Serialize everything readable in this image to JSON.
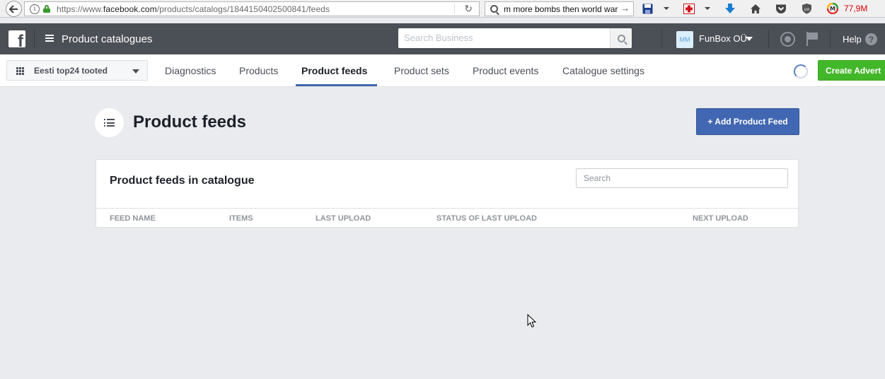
{
  "browser": {
    "url_prefix": "https://www.",
    "url_domain": "facebook.com",
    "url_path": "/products/catalogs/1844150402500841/feeds",
    "search_query": "m more bombs then world war",
    "memory": "77,9M"
  },
  "fb_bar": {
    "section_title": "Product catalogues",
    "search_placeholder": "Search Business",
    "avatar_initials": "MM",
    "account_name": "FunBox OÜ",
    "help_label": "Help"
  },
  "subnav": {
    "catalog_name": "Eesti top24 tooted",
    "tabs": [
      {
        "label": "Diagnostics",
        "active": false
      },
      {
        "label": "Products",
        "active": false
      },
      {
        "label": "Product feeds",
        "active": true
      },
      {
        "label": "Product sets",
        "active": false
      },
      {
        "label": "Product events",
        "active": false
      },
      {
        "label": "Catalogue settings",
        "active": false
      }
    ],
    "create_advert_label": "Create Advert"
  },
  "main": {
    "page_title": "Product feeds",
    "add_feed_label": "+ Add Product Feed",
    "card": {
      "title": "Product feeds in catalogue",
      "search_placeholder": "Search",
      "columns": [
        "FEED NAME",
        "ITEMS",
        "LAST UPLOAD",
        "STATUS OF LAST UPLOAD",
        "NEXT UPLOAD"
      ]
    }
  },
  "colors": {
    "fb_bar": "#4b4f56",
    "primary_blue": "#4267b2",
    "green": "#42b72a",
    "page_bg": "#e9ebee"
  }
}
